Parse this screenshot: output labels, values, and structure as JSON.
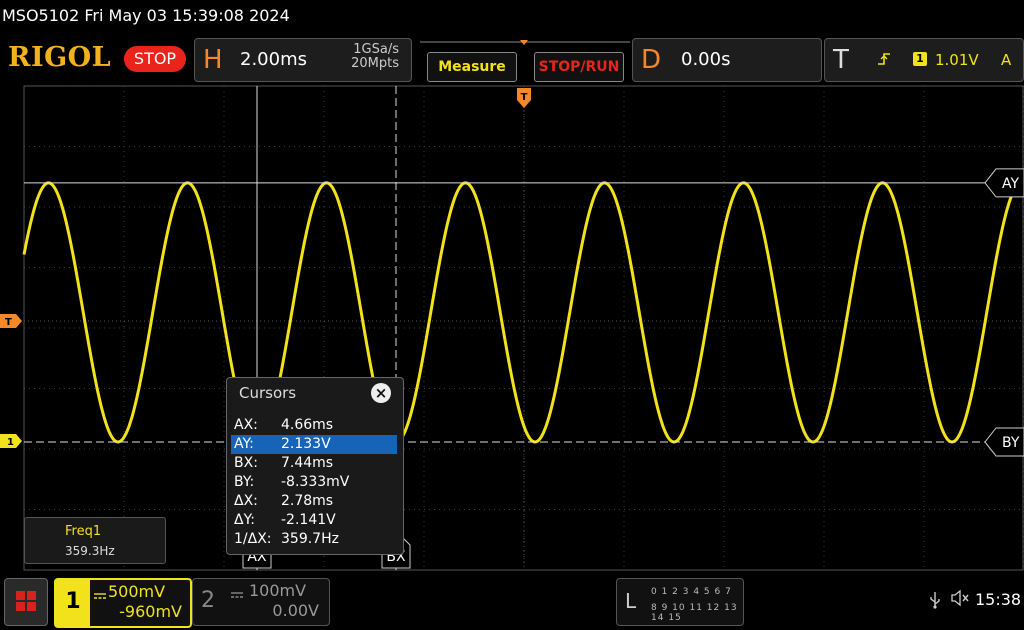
{
  "titlebar": {
    "text": "MSO5102  Fri May 03 15:39:08 2024"
  },
  "logo": "RIGOL",
  "run_state": "STOP",
  "horizontal": {
    "letter": "H",
    "timebase": "2.00ms",
    "sample_rate": "1GSa/s",
    "memory_depth": "20Mpts"
  },
  "buttons": {
    "measure": "Measure",
    "stop_run": "STOP/RUN"
  },
  "delay": {
    "letter": "D",
    "value": "0.00s"
  },
  "trigger": {
    "letter": "T",
    "edge_icon": "rising-edge",
    "source": "1",
    "level": "1.01V",
    "mode": "A"
  },
  "markers": {
    "trigger_left": "T",
    "ch1_ground": "1",
    "trigger_top": "T"
  },
  "cursor_labels": {
    "ay": "AY",
    "by": "BY",
    "ax": "AX",
    "bx": "BX"
  },
  "cursors_panel": {
    "title": "Cursors",
    "close": "×",
    "rows": [
      {
        "key": "AX:",
        "value": "4.66ms"
      },
      {
        "key": "AY:",
        "value": "2.133V"
      },
      {
        "key": "BX:",
        "value": "7.44ms"
      },
      {
        "key": "BY:",
        "value": "-8.333mV"
      },
      {
        "key": "ΔX:",
        "value": "2.78ms"
      },
      {
        "key": "ΔY:",
        "value": "-2.141V"
      },
      {
        "key": "1/ΔX:",
        "value": "359.7Hz"
      }
    ],
    "selected_row": 1
  },
  "measurement": {
    "label": "Freq1",
    "value": "359.3Hz"
  },
  "ch1": {
    "number": "1",
    "scale": "500mV",
    "offset": "-960mV"
  },
  "ch2": {
    "number": "2",
    "scale": "100mV",
    "offset": "0.00V"
  },
  "logic": {
    "letter": "L",
    "row1": "0 1 2 3   4 5 6 7",
    "row2": "8  9 10 11  12 13 14 15"
  },
  "status": {
    "usb_icon": "usb-icon",
    "speaker_icon": "speaker-muted-icon",
    "time": "15:38"
  },
  "colors": {
    "ch1": "#f2e21b",
    "accent_orange": "#f6882a",
    "stop_red": "#e8241b",
    "selection_blue": "#1664b8"
  },
  "waveform": {
    "ch1_period_ms": 2.78,
    "ch1_frequency_hz": 359.7,
    "ch1_max_v": 2.133,
    "ch1_min_v": -0.008,
    "time_div_ms": 2.0,
    "volt_div_mv": 500
  }
}
